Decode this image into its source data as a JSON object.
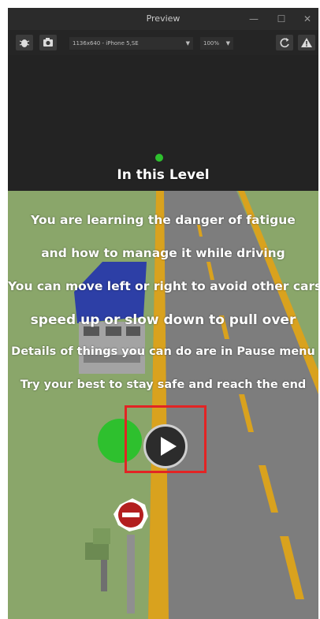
{
  "window": {
    "title": "Preview",
    "minimize_glyph": "—",
    "maximize_glyph": "☐",
    "close_glyph": "✕"
  },
  "toolbar": {
    "bug_icon": "bug-icon",
    "camera_icon": "camera-icon",
    "device_select": "1136x640 - iPhone 5,SE",
    "zoom_select": "100%",
    "refresh_icon": "refresh-icon",
    "warning_icon": "warning-icon"
  },
  "game": {
    "heading": "In this Level",
    "lines": [
      "You are learning the danger of fatigue",
      "and how to manage it while driving",
      "You can move left or right to avoid other cars",
      "speed up or slow down to pull over",
      "Details of things you can do are in Pause menu",
      "Try your best to stay safe and reach the end"
    ],
    "play_icon": "play-icon",
    "colors": {
      "sky": "#232323",
      "grass": "#8aa66a",
      "road": "#7d7d7d",
      "lane_yellow": "#d9a21e",
      "highlight": "#e22424"
    }
  }
}
